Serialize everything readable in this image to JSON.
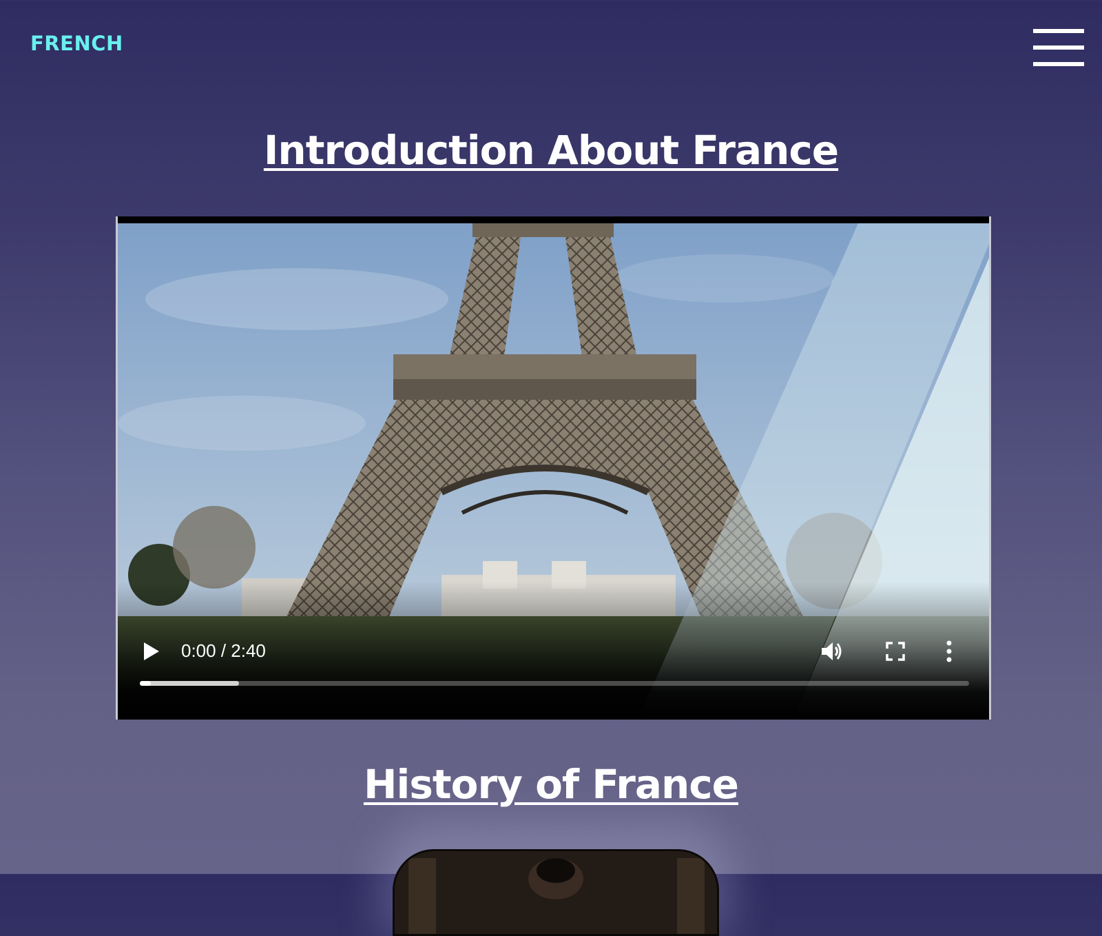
{
  "header": {
    "brand": "FRENCH",
    "menu_icon": "hamburger-menu-icon"
  },
  "sections": [
    {
      "title": "Introduction About France"
    },
    {
      "title": "History of France"
    }
  ],
  "video": {
    "time_display": "0:00 / 2:40",
    "current_time": "0:00",
    "duration": "2:40",
    "buffered_fraction": 0.12,
    "played_fraction": 0.0,
    "icons": [
      "play-icon",
      "volume-icon",
      "fullscreen-icon",
      "more-options-icon"
    ]
  },
  "colors": {
    "brand": "#69f0ee",
    "background_top": "#2f2c62",
    "background_bottom": "#67648a",
    "title": "#ffffff"
  }
}
